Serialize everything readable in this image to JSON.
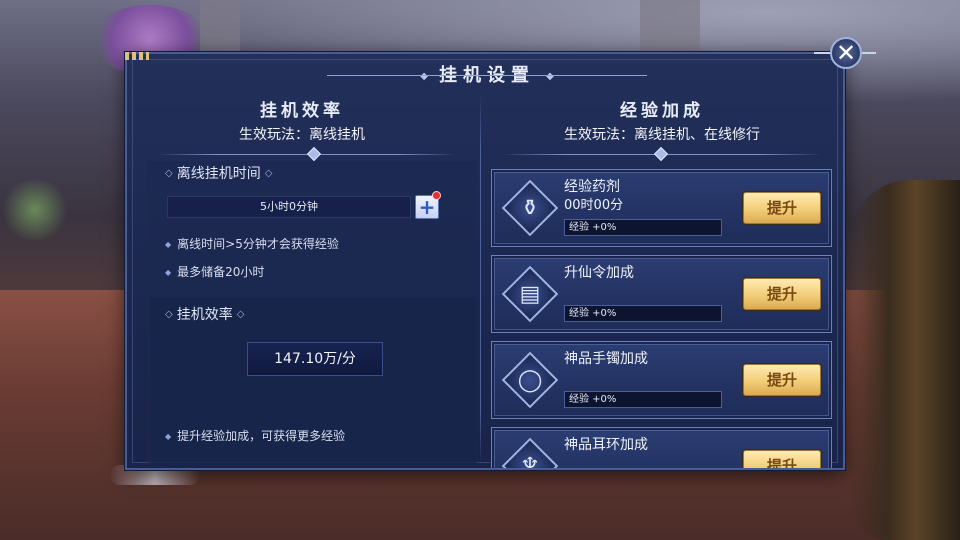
{
  "dialog": {
    "title": "挂机设置",
    "close_icon": "close-icon"
  },
  "left": {
    "heading": "挂机效率",
    "subtitle": "生效玩法：离线挂机",
    "offline_time_label": "离线挂机时间",
    "offline_time_value": "5小时0分钟",
    "add_time_icon": "plus-icon",
    "notes": [
      "离线时间>5分钟才会获得经验",
      "最多储备20小时"
    ],
    "rate_label": "挂机效率",
    "rate_value": "147.10万/分",
    "tip": "提升经验加成，可获得更多经验"
  },
  "right": {
    "heading": "经验加成",
    "subtitle": "生效玩法：离线挂机、在线修行",
    "cards": [
      {
        "name": "经验药剂",
        "time": "00时00分",
        "bar_text": "经验 +0%",
        "bar_fill": 0,
        "button": "提升",
        "icon": "potion-bowl-icon"
      },
      {
        "name": "升仙令加成",
        "time": "",
        "bar_text": "经验 +0%",
        "bar_fill": 0,
        "button": "提升",
        "icon": "token-card-icon"
      },
      {
        "name": "神品手镯加成",
        "time": "",
        "bar_text": "经验 +0%",
        "bar_fill": 0,
        "button": "提升",
        "icon": "bracelet-icon"
      },
      {
        "name": "神品耳环加成",
        "time": "",
        "bar_text": "",
        "bar_fill": 0,
        "button": "提升",
        "icon": "earring-icon"
      }
    ]
  },
  "colors": {
    "panel_bg": "#1c2850",
    "button_gold": "#f2cd78",
    "button_text": "#7a4a12",
    "badge_red": "#e23131"
  }
}
